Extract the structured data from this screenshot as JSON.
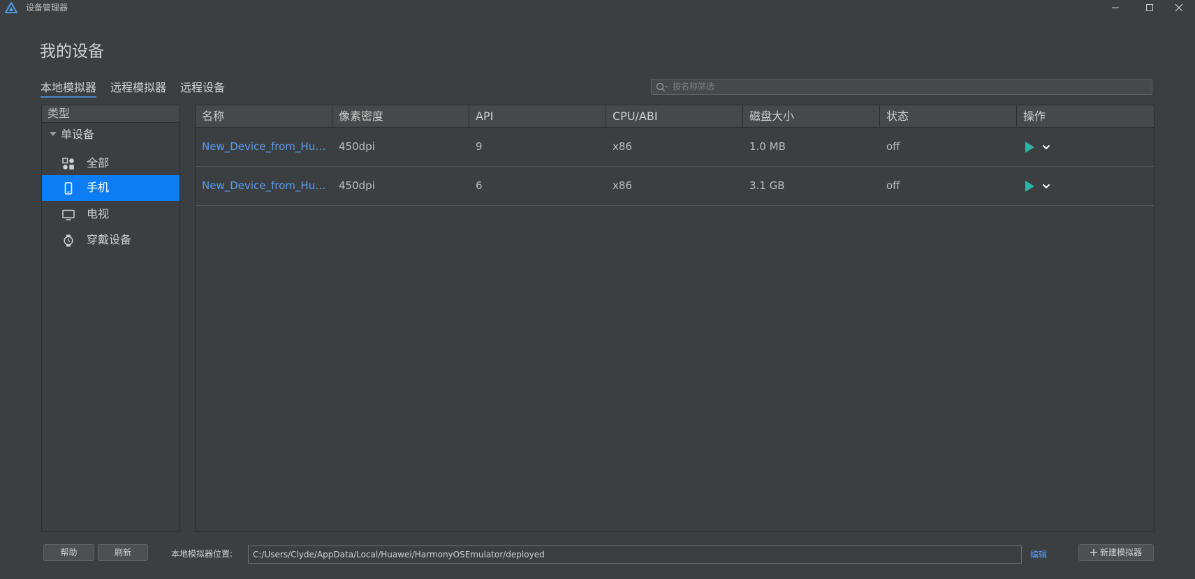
{
  "window": {
    "title": "设备管理器"
  },
  "page": {
    "title": "我的设备"
  },
  "tabs": [
    {
      "label": "本地模拟器",
      "active": true
    },
    {
      "label": "远程模拟器",
      "active": false
    },
    {
      "label": "远程设备",
      "active": false
    }
  ],
  "search": {
    "placeholder": "按名称筛选"
  },
  "sidebar": {
    "header": "类型",
    "group": "单设备",
    "items": [
      {
        "label": "全部",
        "icon": "grid-icon"
      },
      {
        "label": "手机",
        "icon": "phone-icon",
        "selected": true
      },
      {
        "label": "电视",
        "icon": "tv-icon"
      },
      {
        "label": "穿戴设备",
        "icon": "watch-icon"
      }
    ]
  },
  "table": {
    "columns": [
      "名称",
      "像素密度",
      "API",
      "CPU/ABI",
      "磁盘大小",
      "状态",
      "操作"
    ],
    "rows": [
      {
        "name": "New_Device_from_Huawei",
        "density": "450dpi",
        "api": "9",
        "cpu": "x86",
        "disk": "1.0 MB",
        "status": "off"
      },
      {
        "name": "New_Device_from_Huawei",
        "density": "450dpi",
        "api": "6",
        "cpu": "x86",
        "disk": "3.1 GB",
        "status": "off"
      }
    ]
  },
  "footer": {
    "help_label": "帮助",
    "refresh_label": "刷新",
    "path_label": "本地模拟器位置:",
    "path_value": "C:/Users/Clyde/AppData/Local/Huawei/HarmonyOSEmulator/deployed",
    "edit_label": "编辑",
    "new_label": "新建模拟器"
  },
  "colors": {
    "background": "#3c3f41",
    "accent": "#0d7df3",
    "link": "#589df6",
    "play": "#29b6a6"
  }
}
